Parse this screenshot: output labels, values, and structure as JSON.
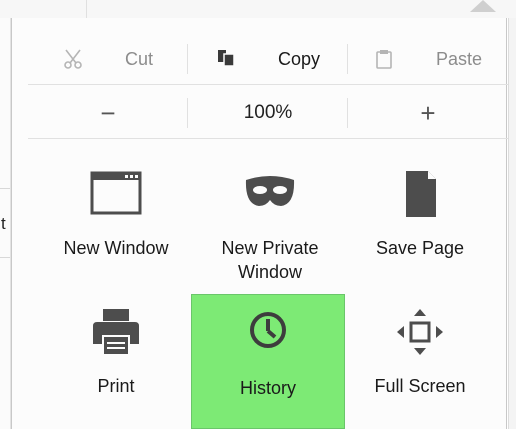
{
  "edit": {
    "cut": "Cut",
    "copy": "Copy",
    "paste": "Paste"
  },
  "zoom": {
    "minus": "−",
    "level": "100%",
    "plus": "+"
  },
  "tiles": {
    "new_window": "New Window",
    "new_private_window_line1": "New Private",
    "new_private_window_line2": "Window",
    "save_page": "Save Page",
    "print": "Print",
    "history": "History",
    "full_screen": "Full Screen"
  },
  "background": {
    "left_char": "t"
  },
  "colors": {
    "highlight": "#7dea75",
    "icon": "#4d4d4d",
    "disabled": "#8c8c8c"
  }
}
